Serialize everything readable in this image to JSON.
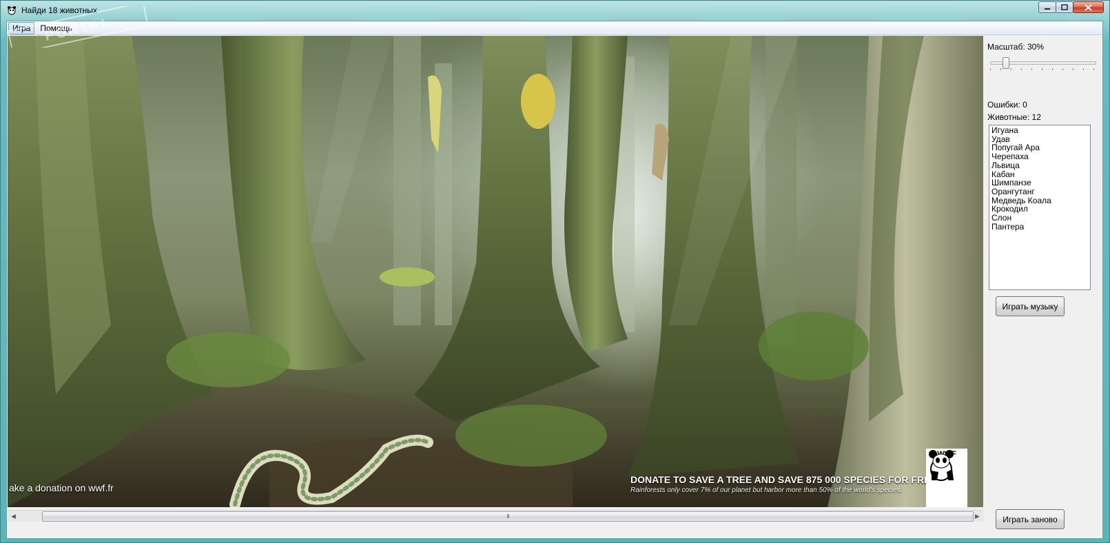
{
  "window": {
    "title": "Найди 18 животных",
    "app_icon": "panda-icon",
    "controls": [
      "minimize-icon",
      "maximize-icon",
      "close-icon"
    ]
  },
  "menu": {
    "items": [
      {
        "label": "Игра",
        "active": true
      },
      {
        "label": "Помощь",
        "active": false
      }
    ]
  },
  "watermark": {
    "text": "PORTAL"
  },
  "scene": {
    "left_caption": "ake a donation on wwf.fr",
    "headline": "DONATE TO SAVE A TREE AND SAVE 875 000 SPECIES FOR FREE.",
    "subline": "Rainforests only cover 7% of our planet but harbor more than 50% of the world's species.",
    "logo_text": "WWF"
  },
  "panel": {
    "zoom_label": "Масштаб: 30%",
    "zoom_percent": 30,
    "errors_label": "Ошибки: 0",
    "animals_label": "Животные: 12",
    "animals": [
      "Игуана",
      "Удав",
      "Попугай Ара",
      "Черепаха",
      "Львица",
      "Кабан",
      "Шимпанзе",
      "Орангутанг",
      "Медведь Коала",
      "Крокодил",
      "Слон",
      "Пантера"
    ],
    "play_music_button": "Играть музыку",
    "restart_button": "Играть заново"
  },
  "scrollbar": {
    "thumb_grip": "Ⅱ"
  }
}
